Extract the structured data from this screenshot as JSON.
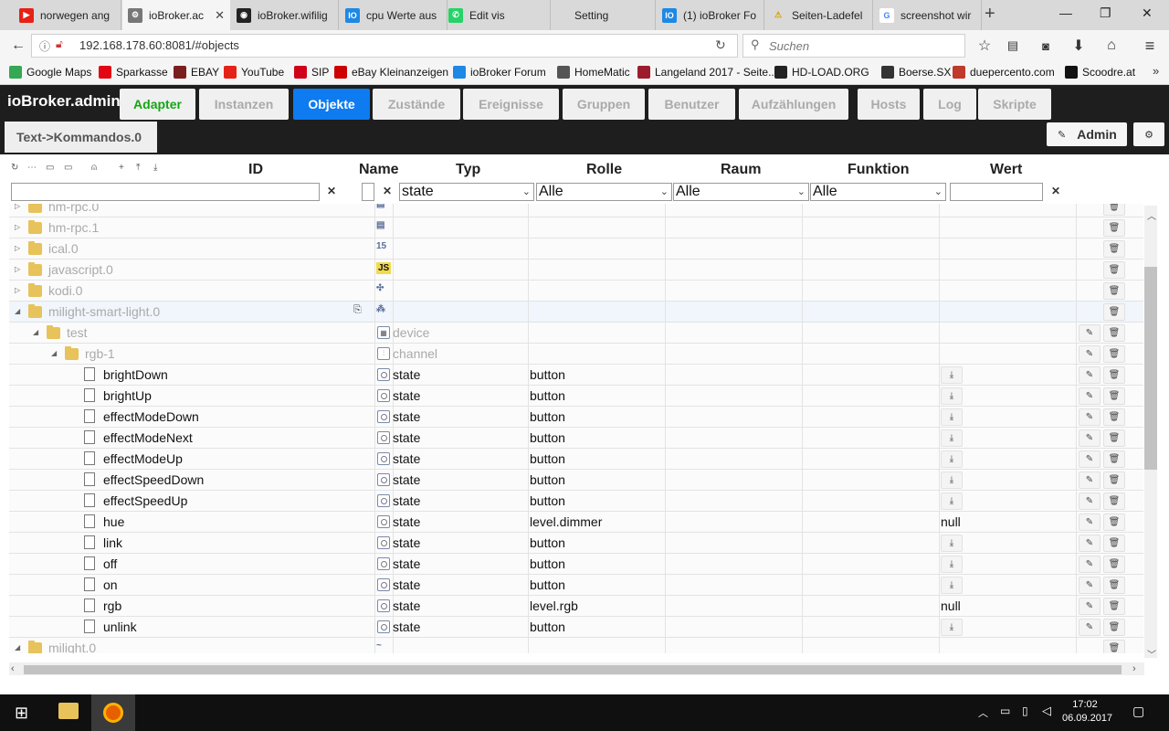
{
  "browser": {
    "tabs": [
      {
        "label": "norwegen ang",
        "icon": "youtube-icon"
      },
      {
        "label": "ioBroker.ac",
        "icon": "gear-icon",
        "active": true
      },
      {
        "label": "ioBroker.wifilig",
        "icon": "github-icon"
      },
      {
        "label": "cpu Werte aus",
        "icon": "iobroker-icon"
      },
      {
        "label": "Edit vis",
        "icon": "whatsapp-icon"
      },
      {
        "label": "Setting",
        "icon": ""
      },
      {
        "label": "(1) ioBroker Fo",
        "icon": "iobroker-icon"
      },
      {
        "label": "Seiten-Ladefel",
        "icon": "warning-icon"
      },
      {
        "label": "screenshot wir",
        "icon": "google-icon"
      }
    ],
    "url": "192.168.178.60:8081/#objects",
    "search_placeholder": "Suchen",
    "bookmarks": [
      {
        "label": "Google Maps",
        "color": "#34a853"
      },
      {
        "label": "Sparkasse",
        "color": "#e30613"
      },
      {
        "label": "EBAY",
        "color": "#7b1e1e"
      },
      {
        "label": "YouTube",
        "color": "#e62117"
      },
      {
        "label": "SIP",
        "color": "#d0021b"
      },
      {
        "label": "eBay Kleinanzeigen",
        "color": "#cc0000"
      },
      {
        "label": "ioBroker Forum",
        "color": "#1e88e5"
      },
      {
        "label": "HomeMatic",
        "color": "#555555"
      },
      {
        "label": "Langeland 2017 - Seite...",
        "color": "#9c1c2c"
      },
      {
        "label": "HD-LOAD.ORG",
        "color": "#222222"
      },
      {
        "label": "Boerse.SX",
        "color": "#333333"
      },
      {
        "label": "duepercento.com",
        "color": "#c0392b"
      },
      {
        "label": "Scoodre.at",
        "color": "#111111"
      }
    ]
  },
  "app": {
    "title": "ioBroker.admin",
    "menu": [
      {
        "label": "Adapter"
      },
      {
        "label": "Instanzen"
      },
      {
        "label": "Objekte",
        "selected": true
      },
      {
        "label": "Zustände"
      },
      {
        "label": "Ereignisse"
      },
      {
        "label": "Gruppen"
      },
      {
        "label": "Benutzer"
      },
      {
        "label": "Aufzählungen"
      },
      {
        "label": "Hosts"
      },
      {
        "label": "Log"
      },
      {
        "label": "Skripte"
      }
    ],
    "subtab": "Text->Kommandos.0",
    "user": "Admin"
  },
  "table": {
    "columns": [
      "ID",
      "Name",
      "Typ",
      "Rolle",
      "Raum",
      "Funktion",
      "Wert"
    ],
    "filters": {
      "id": "",
      "typ": "state",
      "rolle": "Alle",
      "raum": "Alle",
      "funktion": "Alle",
      "wert": ""
    },
    "rows": [
      {
        "id": "hm-rpc.0",
        "level": 0,
        "kind": "folder",
        "expanded": false,
        "dim": true,
        "name_icon": "hm-rpc-icon",
        "typ": "",
        "rolle": "",
        "wert": "",
        "actions": "delete"
      },
      {
        "id": "hm-rpc.1",
        "level": 0,
        "kind": "folder",
        "expanded": false,
        "dim": true,
        "name_icon": "hm-rpc-icon",
        "typ": "",
        "rolle": "",
        "wert": "",
        "actions": "delete"
      },
      {
        "id": "ical.0",
        "level": 0,
        "kind": "folder",
        "expanded": false,
        "dim": true,
        "name_icon": "ical-icon",
        "typ": "",
        "rolle": "",
        "wert": "",
        "actions": "delete"
      },
      {
        "id": "javascript.0",
        "level": 0,
        "kind": "folder",
        "expanded": false,
        "dim": true,
        "name_icon": "javascript-icon",
        "typ": "",
        "rolle": "",
        "wert": "",
        "actions": "delete"
      },
      {
        "id": "kodi.0",
        "level": 0,
        "kind": "folder",
        "expanded": false,
        "dim": true,
        "name_icon": "kodi-icon",
        "typ": "",
        "rolle": "",
        "wert": "",
        "actions": "delete"
      },
      {
        "id": "milight-smart-light.0",
        "level": 0,
        "kind": "folder",
        "expanded": true,
        "dim": true,
        "hl": true,
        "name_icon": "milight-icon",
        "typ": "",
        "rolle": "",
        "wert": "",
        "actions": "delete"
      },
      {
        "id": "test",
        "level": 1,
        "kind": "folder",
        "expanded": true,
        "dim": true,
        "typ_icon": "device-icon",
        "typ": "device",
        "rolle": "",
        "wert": "",
        "actions": "both"
      },
      {
        "id": "rgb-1",
        "level": 2,
        "kind": "folder",
        "expanded": true,
        "dim": true,
        "typ_icon": "channel-icon",
        "typ": "channel",
        "rolle": "",
        "wert": "",
        "actions": "both"
      },
      {
        "id": "brightDown",
        "level": 3,
        "kind": "file",
        "typ": "state",
        "rolle": "button",
        "wert": "btn",
        "actions": "both"
      },
      {
        "id": "brightUp",
        "level": 3,
        "kind": "file",
        "typ": "state",
        "rolle": "button",
        "wert": "btn",
        "actions": "both"
      },
      {
        "id": "effectModeDown",
        "level": 3,
        "kind": "file",
        "typ": "state",
        "rolle": "button",
        "wert": "btn",
        "actions": "both"
      },
      {
        "id": "effectModeNext",
        "level": 3,
        "kind": "file",
        "typ": "state",
        "rolle": "button",
        "wert": "btn",
        "actions": "both"
      },
      {
        "id": "effectModeUp",
        "level": 3,
        "kind": "file",
        "typ": "state",
        "rolle": "button",
        "wert": "btn",
        "actions": "both"
      },
      {
        "id": "effectSpeedDown",
        "level": 3,
        "kind": "file",
        "typ": "state",
        "rolle": "button",
        "wert": "btn",
        "actions": "both"
      },
      {
        "id": "effectSpeedUp",
        "level": 3,
        "kind": "file",
        "typ": "state",
        "rolle": "button",
        "wert": "btn",
        "actions": "both"
      },
      {
        "id": "hue",
        "level": 3,
        "kind": "file",
        "typ": "state",
        "rolle": "level.dimmer",
        "wert": "null",
        "actions": "both"
      },
      {
        "id": "link",
        "level": 3,
        "kind": "file",
        "typ": "state",
        "rolle": "button",
        "wert": "btn",
        "actions": "both"
      },
      {
        "id": "off",
        "level": 3,
        "kind": "file",
        "typ": "state",
        "rolle": "button",
        "wert": "btn",
        "actions": "both"
      },
      {
        "id": "on",
        "level": 3,
        "kind": "file",
        "typ": "state",
        "rolle": "button",
        "wert": "btn",
        "actions": "both"
      },
      {
        "id": "rgb",
        "level": 3,
        "kind": "file",
        "typ": "state",
        "rolle": "level.rgb",
        "wert": "null",
        "actions": "both"
      },
      {
        "id": "unlink",
        "level": 3,
        "kind": "file",
        "typ": "state",
        "rolle": "button",
        "wert": "btn",
        "actions": "both"
      },
      {
        "id": "milight.0",
        "level": 0,
        "kind": "folder",
        "expanded": true,
        "dim": true,
        "name_icon": "easybulb-icon",
        "typ": "",
        "rolle": "",
        "wert": "",
        "actions": "delete"
      }
    ]
  },
  "taskbar": {
    "time": "17:02",
    "date": "06.09.2017"
  }
}
